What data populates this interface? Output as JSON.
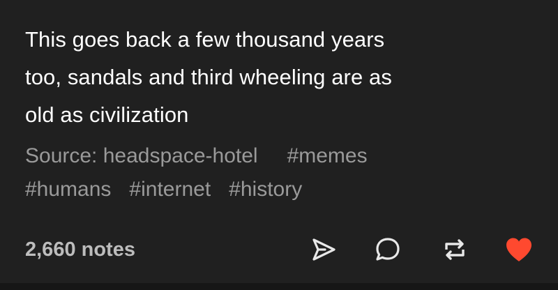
{
  "post": {
    "text_lines": [
      "This goes back a few thousand years",
      "too, sandals and third wheeling are as",
      "old as civilization"
    ],
    "source_label": "Source: headspace-hotel",
    "tags": [
      "#memes",
      "#humans",
      "#internet",
      "#history"
    ],
    "notes": "2,660 notes"
  },
  "actions": [
    {
      "name": "share-icon"
    },
    {
      "name": "reply-icon"
    },
    {
      "name": "reblog-icon"
    },
    {
      "name": "like-heart-icon",
      "color": "#ff492f"
    }
  ],
  "colors": {
    "background": "#202020",
    "text": "#ffffff",
    "muted": "#9a9a9a",
    "like": "#ff492f"
  }
}
